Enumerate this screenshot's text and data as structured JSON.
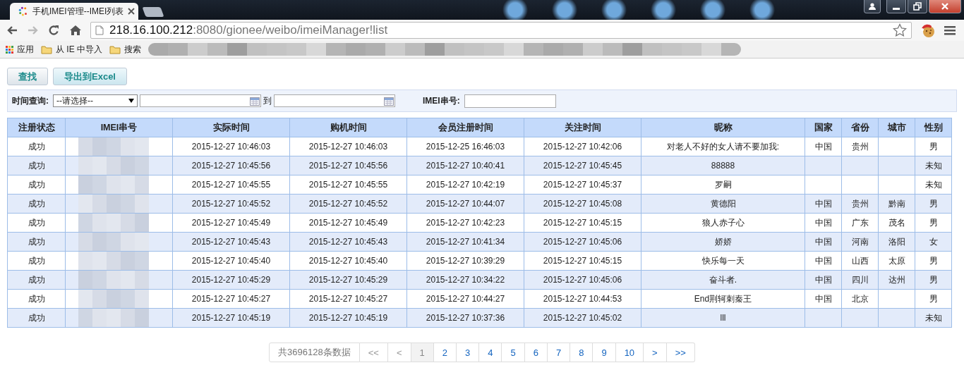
{
  "browser": {
    "tab_title": "手机IMEI管理--IMEI列表",
    "url_host": "218.16.100.212",
    "url_path": ":8080/gionee/weibo/imeiManager!list",
    "bookmarks": [
      {
        "label": "应用",
        "kind": "apps"
      },
      {
        "label": "从 IE 中导入",
        "kind": "folder"
      },
      {
        "label": "搜索",
        "kind": "folder"
      }
    ]
  },
  "actions": [
    "查找",
    "导出到Excel"
  ],
  "filter": {
    "time_label": "时间查询:",
    "time_select": "--请选择--",
    "to_label": "到",
    "imei_label": "IMEI串号:"
  },
  "table": {
    "columns": [
      {
        "label": "注册状态",
        "kind": "text"
      },
      {
        "label": "IMEI串号",
        "kind": "blurred"
      },
      {
        "label": "实际时间",
        "kind": "text"
      },
      {
        "label": "购机时间",
        "kind": "text"
      },
      {
        "label": "会员注册时间",
        "kind": "text"
      },
      {
        "label": "关注时间",
        "kind": "text"
      },
      {
        "label": "昵称",
        "kind": "text"
      },
      {
        "label": "国家",
        "kind": "text"
      },
      {
        "label": "省份",
        "kind": "text"
      },
      {
        "label": "城市",
        "kind": "text"
      },
      {
        "label": "性别",
        "kind": "text"
      }
    ],
    "rows": [
      {
        "status": "成功",
        "actual_time": "2015-12-27 10:46:03",
        "purchase_time": "2015-12-27 10:46:03",
        "register_time": "2015-12-25 16:46:03",
        "follow_time": "2015-12-27 10:42:06",
        "nickname": "对老人不好的女人请不要加我:",
        "country": "中国",
        "province": "贵州",
        "gender": "男"
      },
      {
        "status": "成功",
        "actual_time": "2015-12-27 10:45:56",
        "purchase_time": "2015-12-27 10:45:56",
        "register_time": "2015-12-27 10:40:41",
        "follow_time": "2015-12-27 10:45:45",
        "nickname": "88888",
        "gender": "未知"
      },
      {
        "status": "成功",
        "actual_time": "2015-12-27 10:45:55",
        "purchase_time": "2015-12-27 10:45:55",
        "register_time": "2015-12-27 10:42:19",
        "follow_time": "2015-12-27 10:45:37",
        "nickname": "罗嗣",
        "gender": "未知"
      },
      {
        "status": "成功",
        "actual_time": "2015-12-27 10:45:52",
        "purchase_time": "2015-12-27 10:45:52",
        "register_time": "2015-12-27 10:44:07",
        "follow_time": "2015-12-27 10:45:08",
        "nickname": "黄德阳",
        "country": "中国",
        "province": "贵州",
        "city": "黔南",
        "gender": "男"
      },
      {
        "status": "成功",
        "actual_time": "2015-12-27 10:45:49",
        "purchase_time": "2015-12-27 10:45:49",
        "register_time": "2015-12-27 10:42:23",
        "follow_time": "2015-12-27 10:45:15",
        "nickname": "狼人赤子心",
        "country": "中国",
        "province": "广东",
        "city": "茂名",
        "gender": "男"
      },
      {
        "status": "成功",
        "actual_time": "2015-12-27 10:45:43",
        "purchase_time": "2015-12-27 10:45:43",
        "register_time": "2015-12-27 10:41:34",
        "follow_time": "2015-12-27 10:45:06",
        "nickname": "娇娇",
        "country": "中国",
        "province": "河南",
        "city": "洛阳",
        "gender": "女"
      },
      {
        "status": "成功",
        "actual_time": "2015-12-27 10:45:40",
        "purchase_time": "2015-12-27 10:45:40",
        "register_time": "2015-12-27 10:39:29",
        "follow_time": "2015-12-27 10:45:15",
        "nickname": "快乐每一天",
        "country": "中国",
        "province": "山西",
        "city": "太原",
        "gender": "男"
      },
      {
        "status": "成功",
        "actual_time": "2015-12-27 10:45:29",
        "purchase_time": "2015-12-27 10:45:29",
        "register_time": "2015-12-27 10:34:22",
        "follow_time": "2015-12-27 10:45:06",
        "nickname": "奋斗者.",
        "country": "中国",
        "province": "四川",
        "city": "达州",
        "gender": "男"
      },
      {
        "status": "成功",
        "actual_time": "2015-12-27 10:45:27",
        "purchase_time": "2015-12-27 10:45:27",
        "register_time": "2015-12-27 10:44:27",
        "follow_time": "2015-12-27 10:44:53",
        "nickname": "End荆轲刺秦王",
        "country": "中国",
        "province": "北京",
        "gender": "男"
      },
      {
        "status": "成功",
        "actual_time": "2015-12-27 10:45:19",
        "purchase_time": "2015-12-27 10:45:19",
        "register_time": "2015-12-27 10:37:36",
        "follow_time": "2015-12-27 10:45:02",
        "nickname": "lll",
        "gender": "未知"
      }
    ]
  },
  "pagination": {
    "total": "共3696128条数据",
    "pages": [
      {
        "label": "<<",
        "selected": false,
        "disabled": true
      },
      {
        "label": "<",
        "selected": false,
        "disabled": true
      },
      {
        "label": "1",
        "selected": true,
        "disabled": false
      },
      {
        "label": "2",
        "selected": false,
        "disabled": false
      },
      {
        "label": "3",
        "selected": false,
        "disabled": false
      },
      {
        "label": "4",
        "selected": false,
        "disabled": false
      },
      {
        "label": "5",
        "selected": false,
        "disabled": false
      },
      {
        "label": "6",
        "selected": false,
        "disabled": false
      },
      {
        "label": "7",
        "selected": false,
        "disabled": false
      },
      {
        "label": "8",
        "selected": false,
        "disabled": false
      },
      {
        "label": "9",
        "selected": false,
        "disabled": false
      },
      {
        "label": "10",
        "selected": false,
        "disabled": false
      },
      {
        "label": ">",
        "selected": false,
        "disabled": false
      },
      {
        "label": ">>",
        "selected": false,
        "disabled": false
      }
    ]
  }
}
